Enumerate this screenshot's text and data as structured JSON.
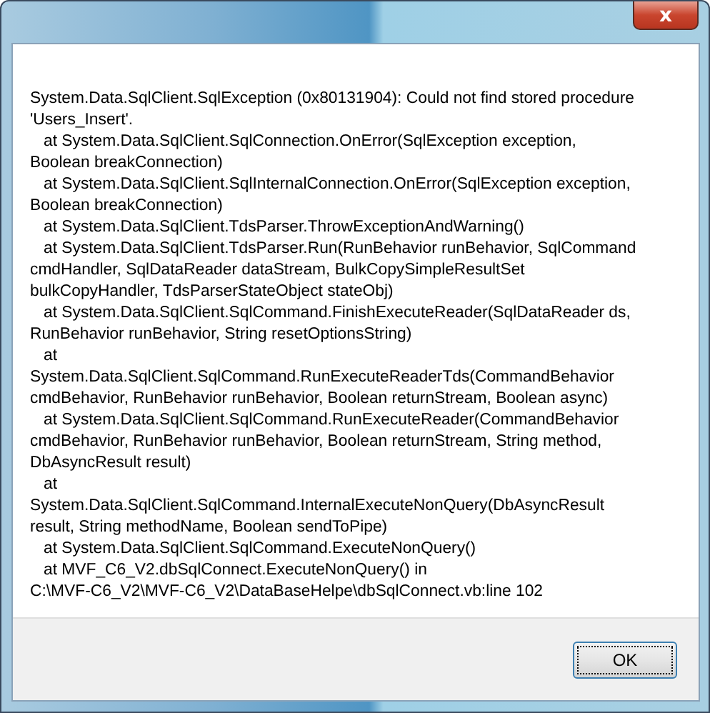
{
  "window": {
    "close_glyph": "x"
  },
  "message": "System.Data.SqlClient.SqlException (0x80131904): Could not find stored procedure\n'Users_Insert'.\n   at System.Data.SqlClient.SqlConnection.OnError(SqlException exception,\nBoolean breakConnection)\n   at System.Data.SqlClient.SqlInternalConnection.OnError(SqlException exception,\nBoolean breakConnection)\n   at System.Data.SqlClient.TdsParser.ThrowExceptionAndWarning()\n   at System.Data.SqlClient.TdsParser.Run(RunBehavior runBehavior, SqlCommand\ncmdHandler, SqlDataReader dataStream, BulkCopySimpleResultSet\nbulkCopyHandler, TdsParserStateObject stateObj)\n   at System.Data.SqlClient.SqlCommand.FinishExecuteReader(SqlDataReader ds,\nRunBehavior runBehavior, String resetOptionsString)\n   at\nSystem.Data.SqlClient.SqlCommand.RunExecuteReaderTds(CommandBehavior\ncmdBehavior, RunBehavior runBehavior, Boolean returnStream, Boolean async)\n   at System.Data.SqlClient.SqlCommand.RunExecuteReader(CommandBehavior\ncmdBehavior, RunBehavior runBehavior, Boolean returnStream, String method,\nDbAsyncResult result)\n   at\nSystem.Data.SqlClient.SqlCommand.InternalExecuteNonQuery(DbAsyncResult\nresult, String methodName, Boolean sendToPipe)\n   at System.Data.SqlClient.SqlCommand.ExecuteNonQuery()\n   at MVF_C6_V2.dbSqlConnect.ExecuteNonQuery() in\nC:\\MVF-C6_V2\\MVF-C6_V2\\DataBaseHelpe\\dbSqlConnect.vb:line 102",
  "buttons": [
    "OK"
  ]
}
